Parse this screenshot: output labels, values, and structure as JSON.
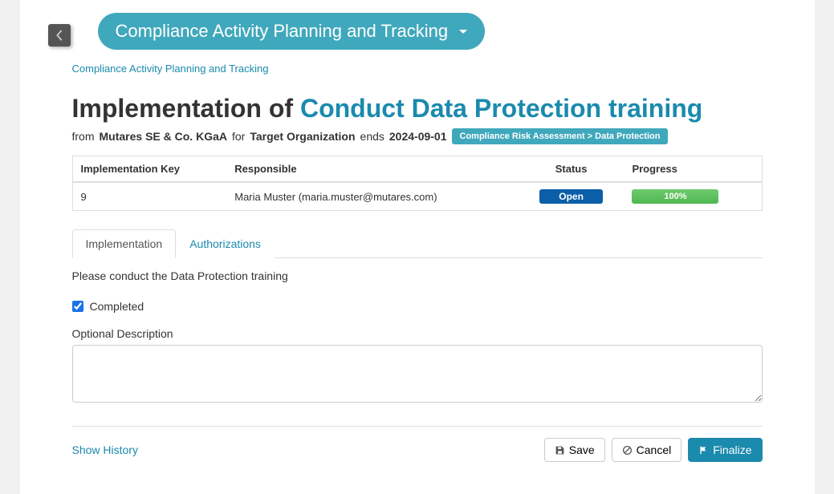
{
  "header": {
    "dropdown_label": "Compliance Activity Planning and Tracking"
  },
  "breadcrumb": "Compliance Activity Planning and Tracking",
  "title": {
    "prefix": "Implementation of ",
    "link": "Conduct Data Protection training"
  },
  "subline": {
    "from_label": "from",
    "from_value": "Mutares SE & Co. KGaA",
    "for_label": "for",
    "for_value": "Target Organization",
    "ends_label": "ends",
    "ends_value": "2024-09-01",
    "badge": "Compliance Risk Assessment > Data Protection"
  },
  "table": {
    "headers": {
      "key": "Implementation Key",
      "responsible": "Responsible",
      "status": "Status",
      "progress": "Progress"
    },
    "row": {
      "key": "9",
      "responsible": "Maria Muster (maria.muster@mutares.com)",
      "status": "Open",
      "progress": "100%"
    }
  },
  "tabs": {
    "implementation": "Implementation",
    "authorizations": "Authorizations"
  },
  "instruction": "Please conduct the Data Protection training",
  "completed_label": "Completed",
  "description_label": "Optional Description",
  "footer": {
    "show_history": "Show History",
    "save": "Save",
    "cancel": "Cancel",
    "finalize": "Finalize"
  }
}
